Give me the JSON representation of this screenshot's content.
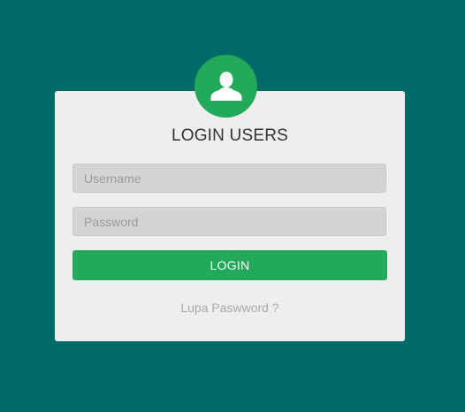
{
  "login": {
    "avatar_icon": "user-icon",
    "title": "LOGIN USERS",
    "username_placeholder": "Username",
    "username_value": "",
    "password_placeholder": "Password",
    "password_value": "",
    "button_label": "LOGIN",
    "forgot_label": "Lupa Paswword ?"
  },
  "colors": {
    "background": "#006a67",
    "card": "#eeeeee",
    "accent": "#22a95a"
  }
}
